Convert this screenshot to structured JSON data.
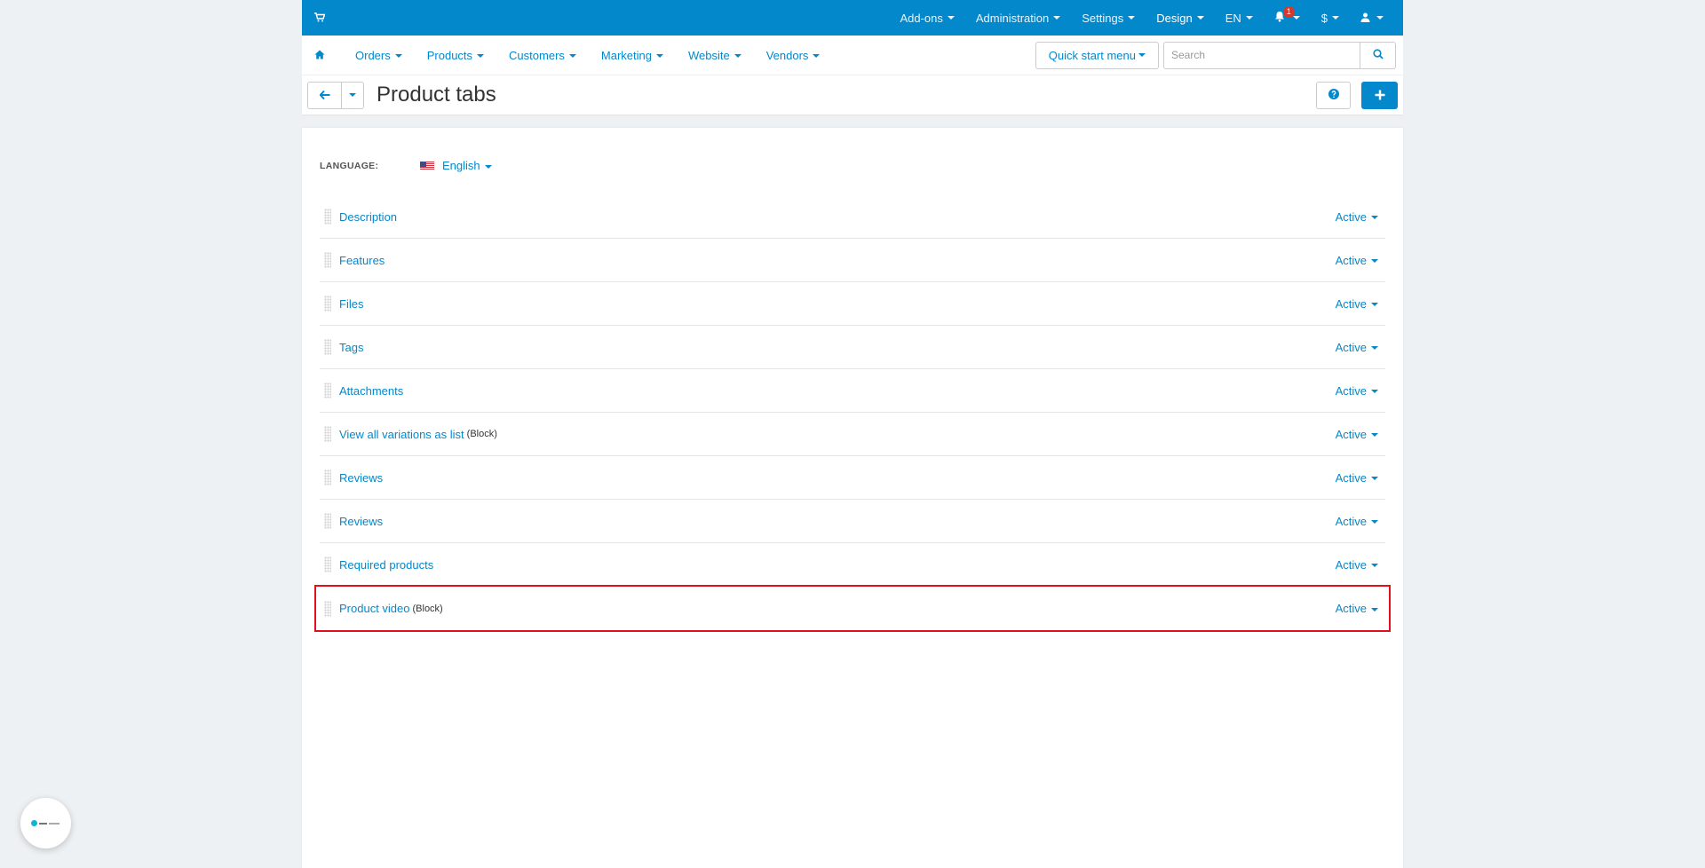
{
  "topbar": {
    "items": [
      {
        "label": "Add-ons"
      },
      {
        "label": "Administration"
      },
      {
        "label": "Settings"
      },
      {
        "label": "Design"
      },
      {
        "label": "EN"
      },
      {
        "label": ""
      },
      {
        "label": "$"
      },
      {
        "label": ""
      }
    ],
    "notification_count": "1"
  },
  "subnav": {
    "items": [
      {
        "label": "Orders"
      },
      {
        "label": "Products"
      },
      {
        "label": "Customers"
      },
      {
        "label": "Marketing"
      },
      {
        "label": "Website"
      },
      {
        "label": "Vendors"
      }
    ],
    "quick_start": "Quick start menu",
    "search_placeholder": "Search"
  },
  "page": {
    "title": "Product tabs"
  },
  "language": {
    "label": "LANGUAGE:",
    "value": "English"
  },
  "tabs": [
    {
      "name": "Description",
      "sub": "",
      "status": "Active"
    },
    {
      "name": "Features",
      "sub": "",
      "status": "Active"
    },
    {
      "name": "Files",
      "sub": "",
      "status": "Active"
    },
    {
      "name": "Tags",
      "sub": "",
      "status": "Active"
    },
    {
      "name": "Attachments",
      "sub": "",
      "status": "Active"
    },
    {
      "name": "View all variations as list",
      "sub": "(Block)",
      "status": "Active"
    },
    {
      "name": "Reviews",
      "sub": "",
      "status": "Active"
    },
    {
      "name": "Reviews",
      "sub": "",
      "status": "Active"
    },
    {
      "name": "Required products",
      "sub": "",
      "status": "Active"
    },
    {
      "name": "Product video",
      "sub": "(Block)",
      "status": "Active"
    }
  ],
  "colors": {
    "brand": "#0388cc",
    "highlight": "#e2101a",
    "badge": "#d33a2f"
  }
}
